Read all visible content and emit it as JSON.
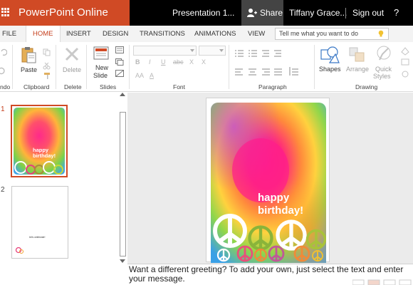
{
  "titlebar": {
    "app_name": "PowerPoint Online",
    "doc_title": "Presentation 1...",
    "share_label": "Share",
    "user_name": "Tiffany Grace...",
    "sign_out": "Sign out",
    "help": "?"
  },
  "tabs": [
    {
      "label": "FILE"
    },
    {
      "label": "HOME",
      "active": true
    },
    {
      "label": "INSERT"
    },
    {
      "label": "DESIGN"
    },
    {
      "label": "TRANSITIONS"
    },
    {
      "label": "ANIMATIONS"
    },
    {
      "label": "VIEW"
    }
  ],
  "tell_me": {
    "placeholder": "Tell me what you want to do"
  },
  "ribbon": {
    "undo_group_label": "ndo",
    "clipboard": {
      "label": "Clipboard",
      "paste": "Paste"
    },
    "delete": {
      "label": "Delete",
      "button": "Delete"
    },
    "slides": {
      "label": "Slides",
      "new_slide_1": "New",
      "new_slide_2": "Slide"
    },
    "font": {
      "label": "Font",
      "bold": "B",
      "italic": "I",
      "underline": "U",
      "strike": "abc",
      "sub": "X",
      "sup": "X",
      "aa": "AA",
      "a_color": "A"
    },
    "paragraph": {
      "label": "Paragraph"
    },
    "drawing": {
      "label": "Drawing",
      "shapes": "Shapes",
      "arrange": "Arrange",
      "quick_styles_1": "Quick",
      "quick_styles_2": "Styles"
    }
  },
  "thumbnails": [
    {
      "number": "1",
      "text_1": "happy",
      "text_2": "birthday!"
    },
    {
      "number": "2",
      "text_1": "let's celebrate!"
    }
  ],
  "slide": {
    "greeting_1": "happy",
    "greeting_2": "birthday!"
  },
  "notes": {
    "text": "Want a different greeting? To add your own, just select the text and enter your message."
  },
  "colors": {
    "brand": "#d04a25",
    "active_tab": "#c43e1c",
    "titlebar": "#000000",
    "share": "#444444"
  }
}
